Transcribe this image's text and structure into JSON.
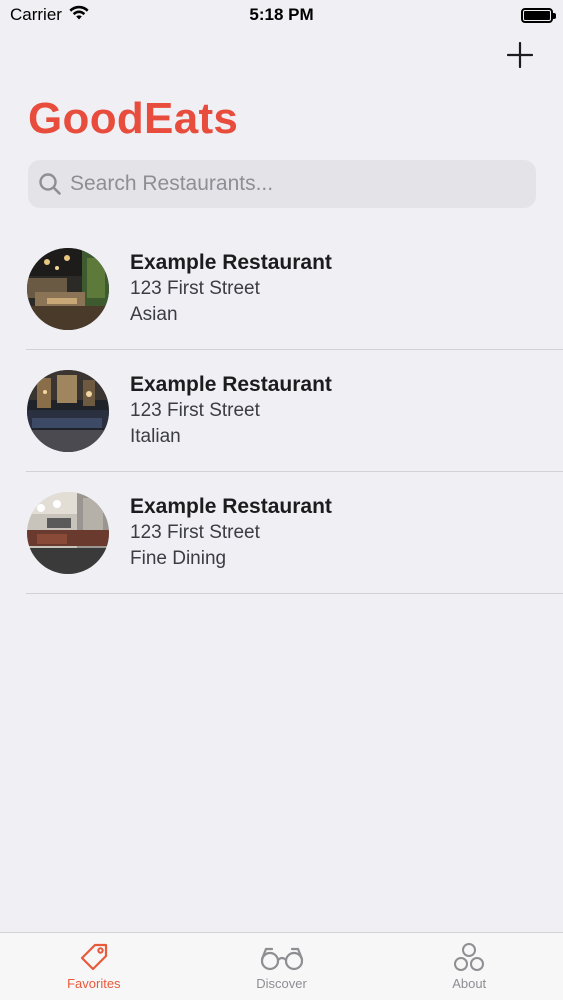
{
  "status_bar": {
    "carrier": "Carrier",
    "time": "5:18 PM"
  },
  "nav": {
    "title": "GoodEats",
    "add_icon": "plus-icon"
  },
  "search": {
    "placeholder": "Search Restaurants..."
  },
  "restaurants": [
    {
      "name": "Example Restaurant",
      "address": "123 First Street",
      "type": "Asian"
    },
    {
      "name": "Example Restaurant",
      "address": "123 First Street",
      "type": "Italian"
    },
    {
      "name": "Example Restaurant",
      "address": "123 First Street",
      "type": "Fine Dining"
    }
  ],
  "tab_bar": {
    "tabs": [
      {
        "label": "Favorites",
        "icon": "tag-icon",
        "active": true
      },
      {
        "label": "Discover",
        "icon": "glasses-icon",
        "active": false
      },
      {
        "label": "About",
        "icon": "circles-icon",
        "active": false
      }
    ]
  },
  "colors": {
    "accent": "#e74c3c",
    "tab_active": "#e85a3a",
    "tab_inactive": "#8e8e93",
    "background": "#efeff4"
  }
}
